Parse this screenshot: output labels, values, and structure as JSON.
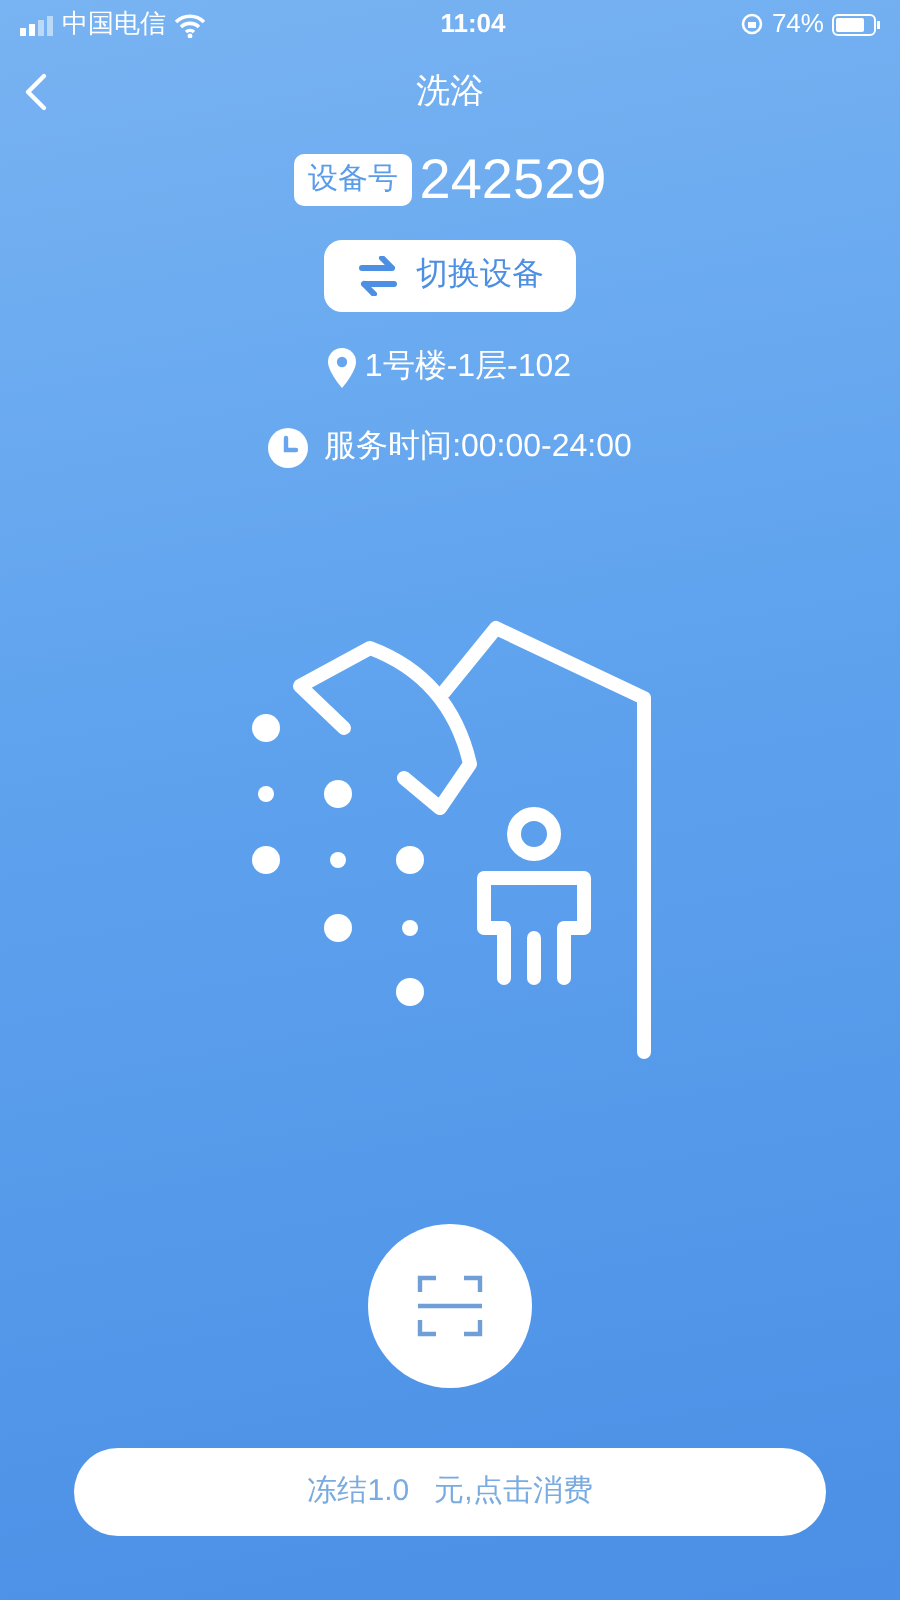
{
  "status_bar": {
    "carrier": "中国电信",
    "time": "11:04",
    "battery": "74%"
  },
  "header": {
    "title": "洗浴"
  },
  "device": {
    "label": "设备号",
    "number": "242529"
  },
  "switch_button": {
    "label": "切换设备"
  },
  "location": "1号楼-1层-102",
  "service_time": "服务时间:00:00-24:00",
  "consume_button": {
    "label": "冻结1.0   元,点击消费"
  }
}
